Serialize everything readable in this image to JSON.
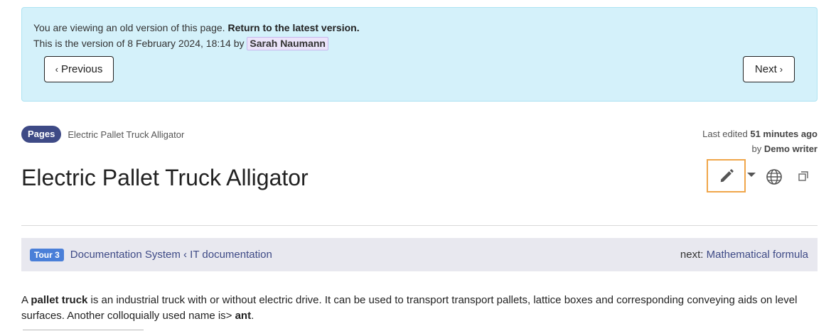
{
  "notice": {
    "line1_prefix": "You are viewing an old version of this page.",
    "line1_link": "Return to the latest version.",
    "line2_prefix": "This is the version of 8 February 2024, 18:14 by",
    "author": "Sarah Naumann",
    "prev_label": "Previous",
    "next_label": "Next"
  },
  "breadcrumb": {
    "pill": "Pages",
    "current": "Electric Pallet Truck Alligator"
  },
  "meta": {
    "last_edited_prefix": "Last edited",
    "last_edited_time": "51 minutes ago",
    "by_prefix": "by",
    "editor": "Demo writer"
  },
  "title": "Electric Pallet Truck Alligator",
  "actions": {
    "icons": [
      "pencil-icon",
      "chevron-down-icon",
      "globe-icon",
      "window-icon"
    ],
    "highlight_color": "#f0a64a"
  },
  "tour": {
    "badge": "Tour 3",
    "path": "Documentation System ‹ IT documentation",
    "next_prefix": "next:",
    "next_link": "Mathematical formula"
  },
  "content": {
    "p1_a": "A ",
    "p1_bold": "pallet truck",
    "p1_b": " is an industrial truck with or without electric drive. It can be used to transport transport pallets, lattice boxes and corresponding conveying aids on level surfaces. Another colloquially used name is> ",
    "p1_bold2": "ant",
    "p1_c": "."
  },
  "colors": {
    "notice_bg": "#d4f1fa",
    "pill_bg": "#3e4a86",
    "tour_badge_bg": "#4a7fd8",
    "link": "#3e4a86"
  }
}
